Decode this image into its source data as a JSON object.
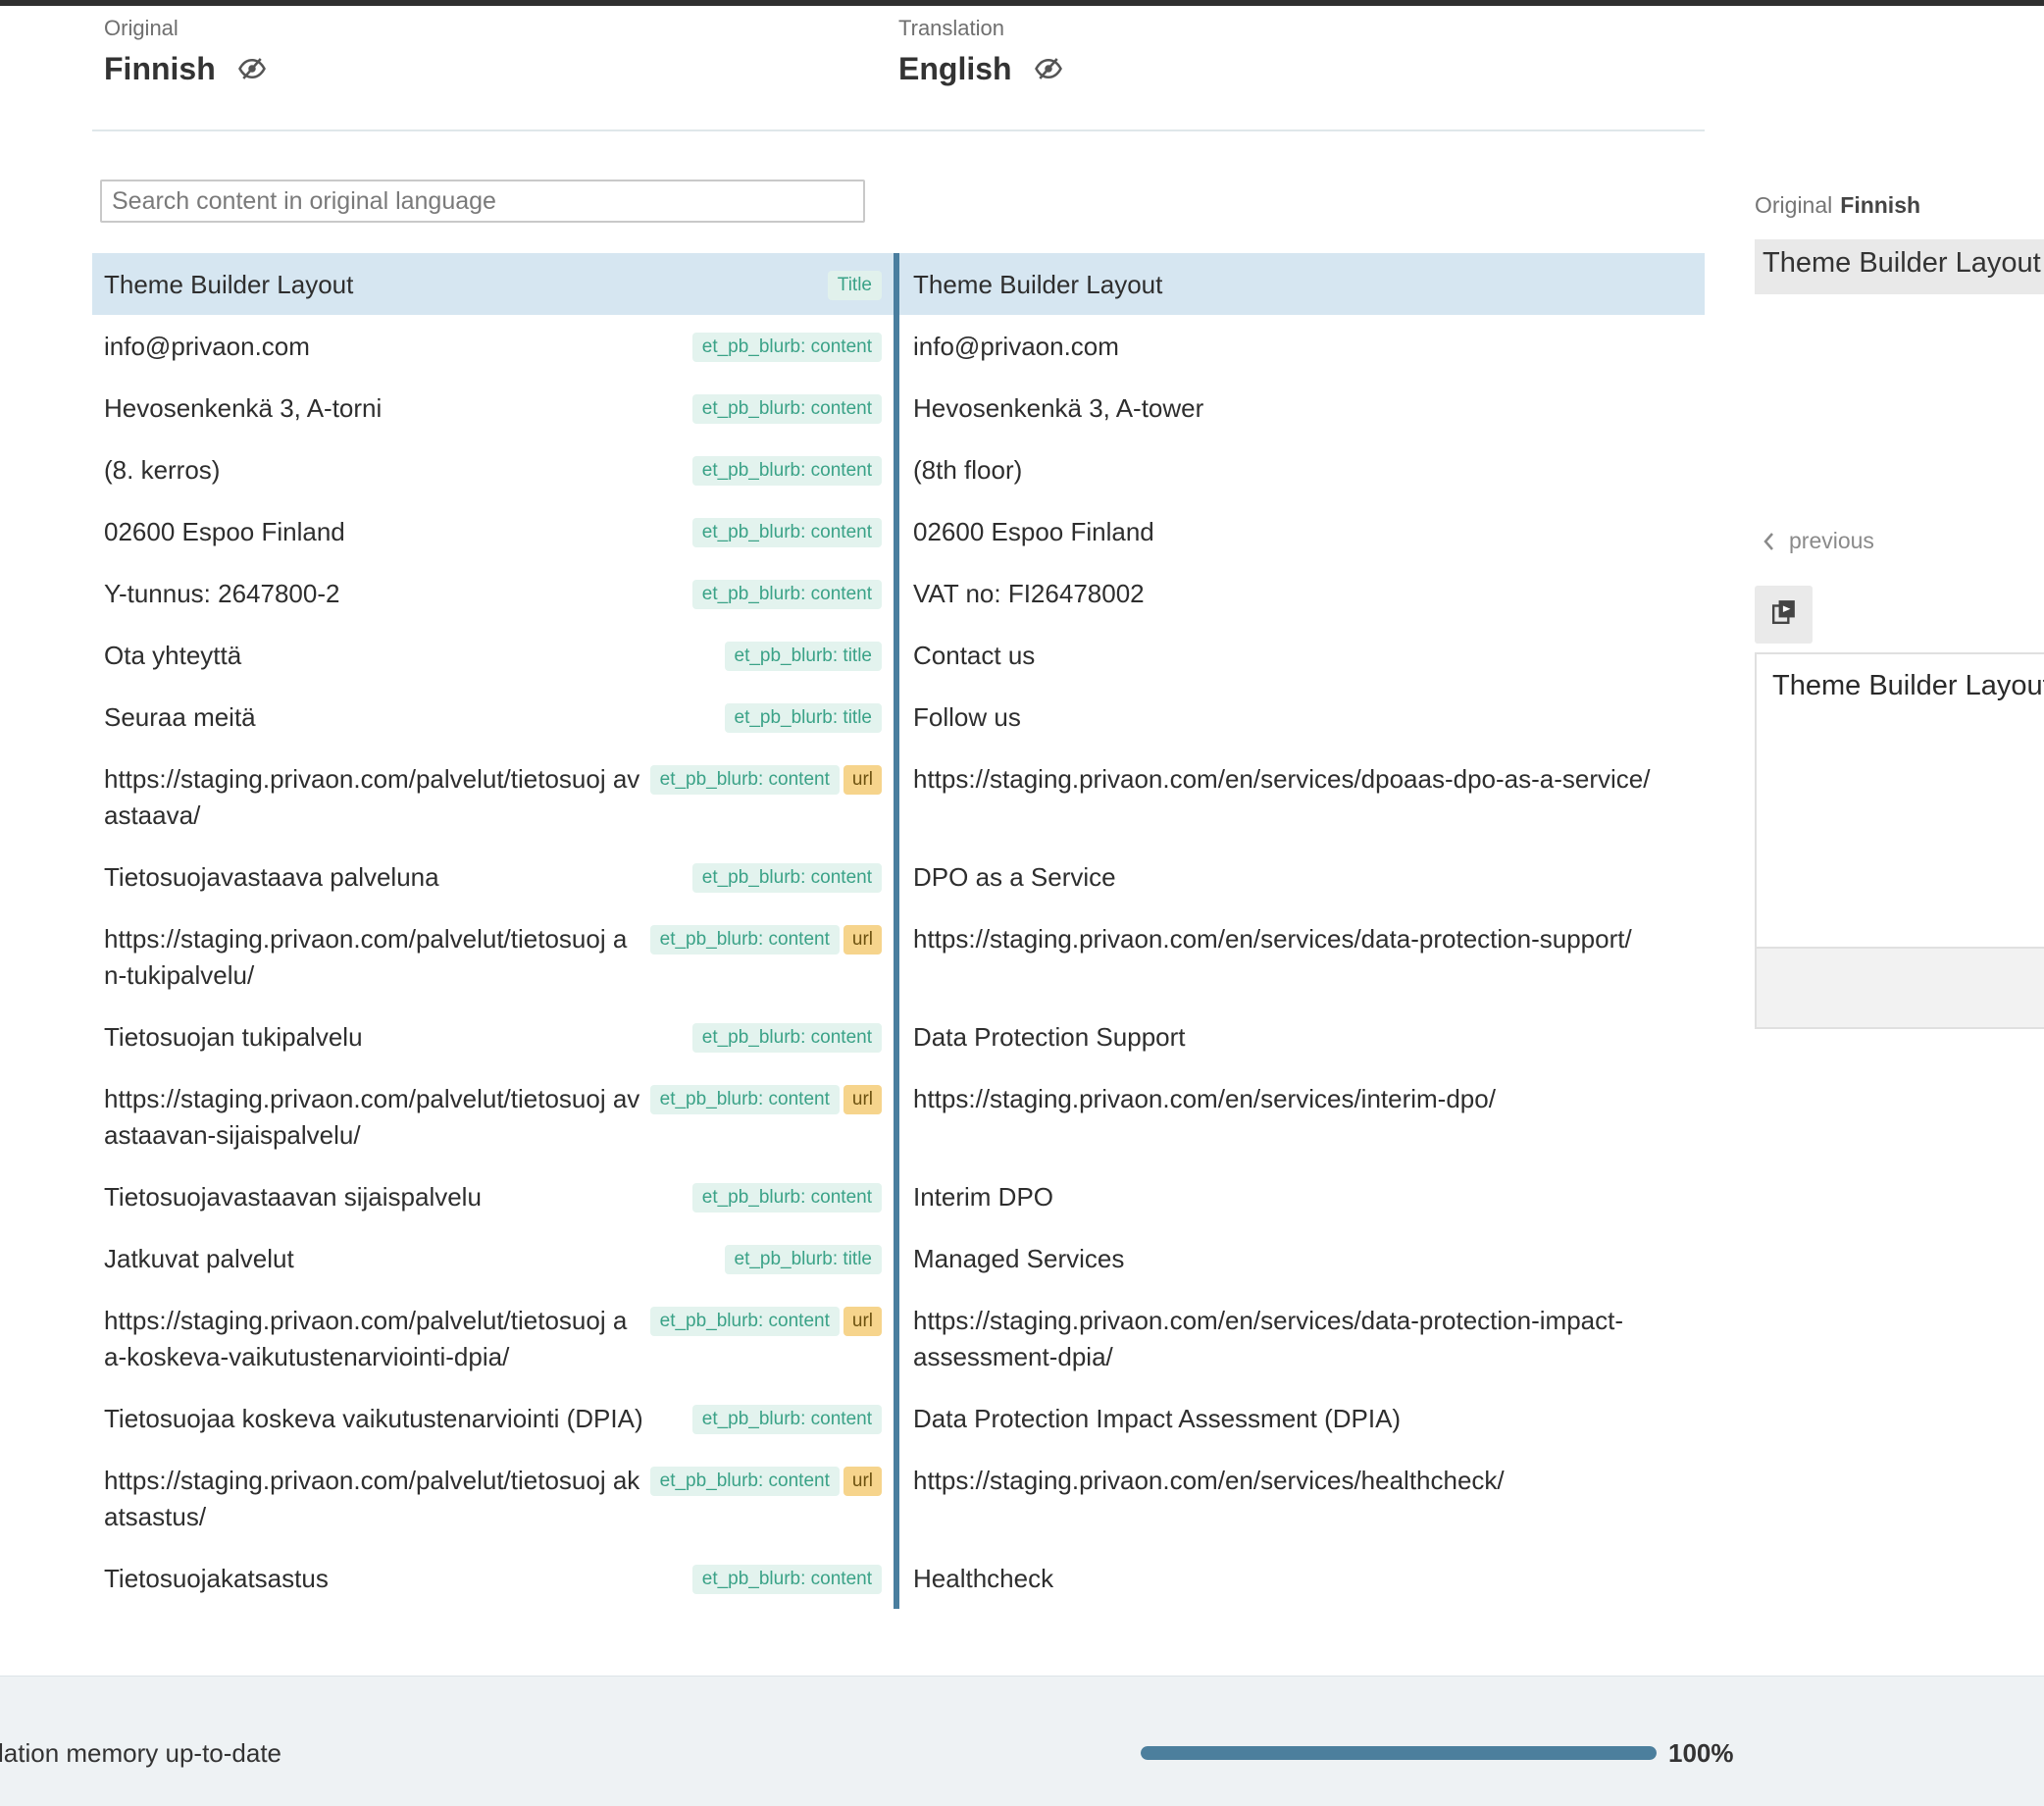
{
  "header": {
    "original": {
      "kicker": "Original",
      "language": "Finnish"
    },
    "translation": {
      "kicker": "Translation",
      "language": "English"
    }
  },
  "search": {
    "placeholder": "Search content in original language"
  },
  "rows": [
    {
      "original": "Theme Builder Layout",
      "tags": [
        "Title"
      ],
      "translation": "Theme Builder Layout",
      "selected": true
    },
    {
      "original": "info@privaon.com",
      "tags": [
        "et_pb_blurb: content"
      ],
      "translation": "info@privaon.com"
    },
    {
      "original": "Hevosenkenkä 3, A-torni",
      "tags": [
        "et_pb_blurb: content"
      ],
      "translation": "Hevosenkenkä 3, A-tower"
    },
    {
      "original": "(8. kerros)",
      "tags": [
        "et_pb_blurb: content"
      ],
      "translation": "(8th floor)"
    },
    {
      "original": "02600 Espoo Finland",
      "tags": [
        "et_pb_blurb: content"
      ],
      "translation": "02600 Espoo Finland"
    },
    {
      "original": "Y-tunnus: 2647800-2",
      "tags": [
        "et_pb_blurb: content"
      ],
      "translation": "VAT no: FI26478002"
    },
    {
      "original": "Ota yhteyttä",
      "tags": [
        "et_pb_blurb: title"
      ],
      "translation": "Contact us"
    },
    {
      "original": "Seuraa meitä",
      "tags": [
        "et_pb_blurb: title"
      ],
      "translation": "Follow us"
    },
    {
      "original": "https://staging.privaon.com/palvelut/tietosuoj avastaava/",
      "tags": [
        "et_pb_blurb: content",
        "url"
      ],
      "translation": "https://staging.privaon.com/en/services/dpoaas-dpo-as-a-service/"
    },
    {
      "original": "Tietosuojavastaava palveluna",
      "tags": [
        "et_pb_blurb: content"
      ],
      "translation": "DPO as a Service"
    },
    {
      "original": "https://staging.privaon.com/palvelut/tietosuoj an-tukipalvelu/",
      "tags": [
        "et_pb_blurb: content",
        "url"
      ],
      "translation": "https://staging.privaon.com/en/services/data-protection-support/"
    },
    {
      "original": "Tietosuojan tukipalvelu",
      "tags": [
        "et_pb_blurb: content"
      ],
      "translation": "Data Protection Support"
    },
    {
      "original": "https://staging.privaon.com/palvelut/tietosuoj avastaavan-sijaispalvelu/",
      "tags": [
        "et_pb_blurb: content",
        "url"
      ],
      "translation": "https://staging.privaon.com/en/services/interim-dpo/"
    },
    {
      "original": "Tietosuojavastaavan sijaispalvelu",
      "tags": [
        "et_pb_blurb: content"
      ],
      "translation": "Interim DPO"
    },
    {
      "original": "Jatkuvat palvelut",
      "tags": [
        "et_pb_blurb: title"
      ],
      "translation": "Managed Services"
    },
    {
      "original": "https://staging.privaon.com/palvelut/tietosuoj aa-koskeva-vaikutustenarviointi-dpia/",
      "tags": [
        "et_pb_blurb: content",
        "url"
      ],
      "translation": "https://staging.privaon.com/en/services/data-protection-impact- assessment-dpia/"
    },
    {
      "original": "Tietosuojaa koskeva vaikutustenarviointi (DPIA)",
      "tags": [
        "et_pb_blurb: content"
      ],
      "translation": "Data Protection Impact Assessment (DPIA)"
    },
    {
      "original": "https://staging.privaon.com/palvelut/tietosuoj akatsastus/",
      "tags": [
        "et_pb_blurb: content",
        "url"
      ],
      "translation": "https://staging.privaon.com/en/services/healthcheck/"
    },
    {
      "original": "Tietosuojakatsastus",
      "tags": [
        "et_pb_blurb: content"
      ],
      "translation": "Healthcheck"
    }
  ],
  "side_panel": {
    "original_label": "Original",
    "original_language": "Finnish",
    "original_text": "Theme Builder Layout",
    "previous_label": "previous",
    "editor_text": "Theme Builder Layout"
  },
  "footer": {
    "status": "lation memory up-to-date",
    "progress_percent": 100,
    "progress_label": "100%"
  },
  "colors": {
    "accent": "#4c7f9d",
    "selected_row": "#d6e6f1",
    "tag_bg": "#e3f3ee",
    "tag_text": "#3aa287",
    "url_tag_bg": "#f6d48c"
  },
  "icons": {
    "visibility": "eye-slash-icon",
    "previous": "chevron-left-icon",
    "copy": "copy-original-icon"
  }
}
